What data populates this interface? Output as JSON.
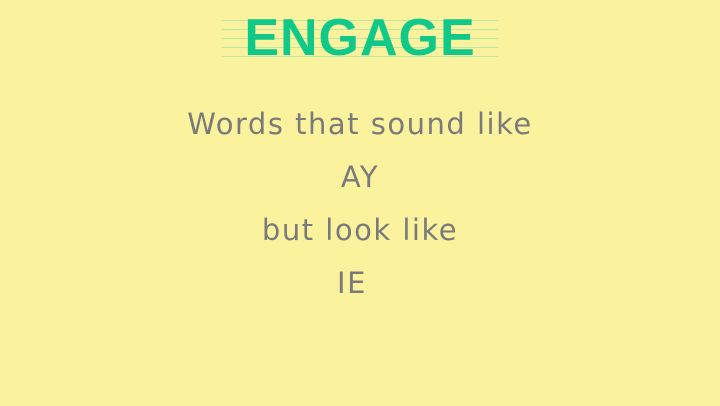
{
  "slide": {
    "title": "ENGAGE",
    "lines": [
      "Words that sound like",
      "AY",
      "but look like",
      "IE"
    ]
  },
  "colors": {
    "background": "#fbf29e",
    "title": "#10c988",
    "text": "#7a7a7a",
    "title_rule": "#b9e8a9"
  }
}
